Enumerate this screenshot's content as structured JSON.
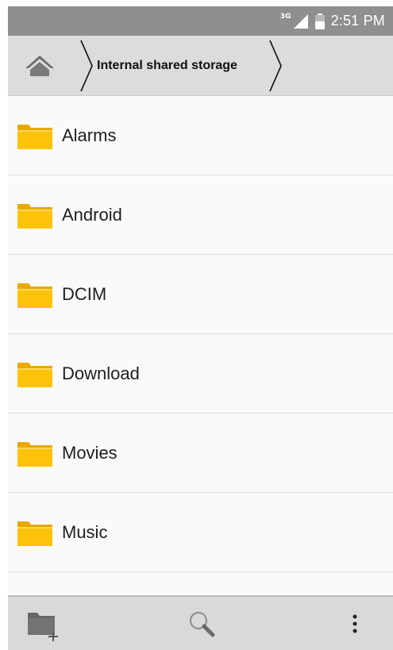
{
  "status_bar": {
    "network": "3G",
    "time": "2:51 PM",
    "icons": [
      "signal-icon",
      "battery-icon"
    ]
  },
  "breadcrumb": {
    "home_icon": "home-icon",
    "items": [
      {
        "label": "Internal shared storage"
      }
    ]
  },
  "file_list": {
    "items": [
      {
        "name": "Alarms",
        "icon": "folder-icon"
      },
      {
        "name": "Android",
        "icon": "folder-icon"
      },
      {
        "name": "DCIM",
        "icon": "folder-icon"
      },
      {
        "name": "Download",
        "icon": "folder-icon"
      },
      {
        "name": "Movies",
        "icon": "folder-icon"
      },
      {
        "name": "Music",
        "icon": "folder-icon"
      }
    ]
  },
  "toolbar": {
    "new_folder_icon": "new-folder-icon",
    "search_icon": "search-icon",
    "more_icon": "more-options-icon"
  },
  "colors": {
    "status_bar": "#8f8f8f",
    "breadcrumb_bar": "#dcdcdc",
    "list_background": "#fafafa",
    "folder_yellow": "#fcc30a",
    "toolbar": "#d9d9d9"
  }
}
